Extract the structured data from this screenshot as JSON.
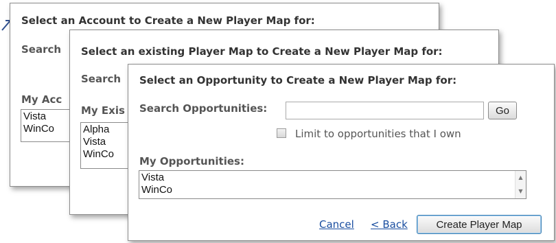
{
  "dialog_account": {
    "title": "Select an Account to Create a New Player Map for:",
    "search_label": "Search",
    "list_label": "My Acc",
    "items": [
      "Vista",
      "WinCo"
    ]
  },
  "dialog_player_map": {
    "title": "Select an existing Player Map to Create a New Player Map for:",
    "search_label": "Search",
    "list_label": "My Exis",
    "items": [
      "Alpha",
      "Vista",
      "WinCo"
    ]
  },
  "dialog_opportunity": {
    "title": "Select an Opportunity to Create a New Player Map for:",
    "search_label": "Search Opportunities:",
    "search_value": "",
    "go_label": "Go",
    "limit_checkbox_label": "Limit to opportunities that I own",
    "limit_checked": false,
    "list_label": "My Opportunities:",
    "items": [
      "Vista",
      "WinCo"
    ],
    "cancel_label": "Cancel",
    "back_label": "< Back",
    "create_label": "Create Player Map"
  },
  "colors": {
    "link": "#1a4ea0",
    "primary_button_border": "#3c7fb1"
  }
}
